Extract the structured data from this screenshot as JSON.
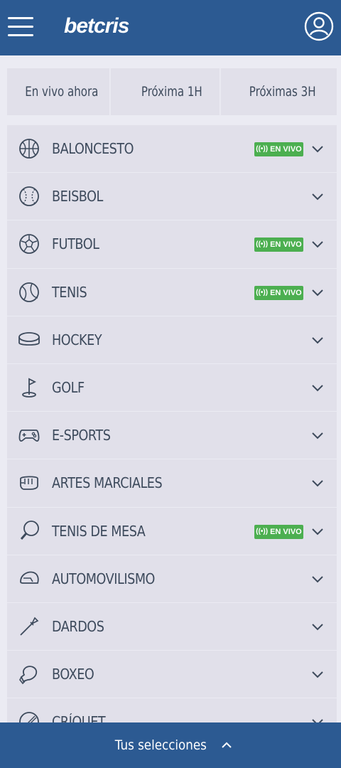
{
  "header": {
    "logo_text": "betcris",
    "menu_icon": "hamburger-menu-icon",
    "user_icon": "user-account-icon"
  },
  "time_filters": [
    {
      "label": "En vivo ahora"
    },
    {
      "label": "Próxima 1H"
    },
    {
      "label": "Próximas 3H"
    }
  ],
  "sports": [
    {
      "label": "BALONCESTO",
      "icon": "basketball-icon",
      "live": true
    },
    {
      "label": "BEISBOL",
      "icon": "baseball-icon",
      "live": false
    },
    {
      "label": "FUTBOL",
      "icon": "soccer-ball-icon",
      "live": true
    },
    {
      "label": "TENIS",
      "icon": "tennis-ball-icon",
      "live": true
    },
    {
      "label": "HOCKEY",
      "icon": "hockey-puck-icon",
      "live": false
    },
    {
      "label": "GOLF",
      "icon": "golf-flag-icon",
      "live": false
    },
    {
      "label": "E-SPORTS",
      "icon": "gamepad-icon",
      "live": false
    },
    {
      "label": "ARTES MARCIALES",
      "icon": "fist-icon",
      "live": false
    },
    {
      "label": "TENIS DE MESA",
      "icon": "ping-pong-paddle-icon",
      "live": true
    },
    {
      "label": "AUTOMOVILISMO",
      "icon": "racing-helmet-icon",
      "live": false
    },
    {
      "label": "DARDOS",
      "icon": "dart-icon",
      "live": false
    },
    {
      "label": "BOXEO",
      "icon": "boxing-glove-icon",
      "live": false
    },
    {
      "label": "CRÍQUET",
      "icon": "cricket-ball-icon",
      "live": false
    }
  ],
  "live_badge_text": "EN VIVO",
  "footer": {
    "label": "Tus selecciones"
  },
  "colors": {
    "brand_blue": "#2c5a92",
    "live_green": "#4caf50",
    "row_bg": "#e1e0ea",
    "page_bg": "#ebebf3",
    "text": "#3d4a5c"
  }
}
